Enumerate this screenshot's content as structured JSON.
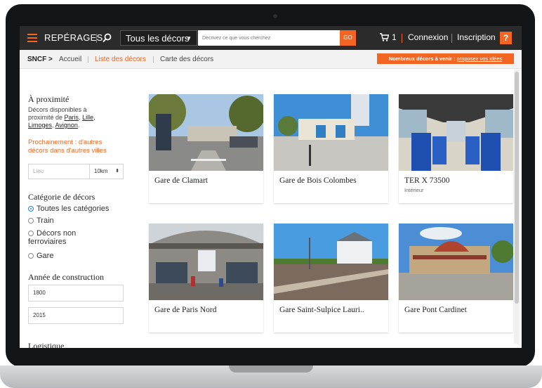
{
  "header": {
    "brand": "REPÉRAGES",
    "decor_dropdown": "Tous les décors",
    "search_placeholder": "Décrivez ce que vous cherchez",
    "go_label": "GO",
    "cart_count": "1",
    "connexion": "Connexion",
    "inscription": "Inscription",
    "help": "?"
  },
  "breadcrumb": {
    "sncf": "SNCF >",
    "home": "Accueil",
    "list": "Liste des décors",
    "map": "Carte des décors"
  },
  "promo": {
    "text": "Nombreux décors à venir : ",
    "link": "proposez vos idées"
  },
  "sidebar": {
    "nearby_title": "À proximité",
    "nearby_text": "Décors disponibles à proximité de ",
    "cities": [
      "Paris",
      "Lille",
      "Limoges",
      "Avignon"
    ],
    "soon_text": "Prochainement : d'autres décors dans d'autres villes",
    "location_placeholder": "Lieu",
    "radius": "10km",
    "category_title": "Catégorie de décors",
    "categories": [
      "Toutes les catégories",
      "Train",
      "Décors non ferroviaires",
      "Gare"
    ],
    "year_title": "Année de construction",
    "year_from": "1800",
    "year_to": "2015",
    "logistics_title": "Logistique"
  },
  "cards": [
    {
      "title": "Gare de Clamart",
      "sub": ""
    },
    {
      "title": "Gare de Bois Colombes",
      "sub": ""
    },
    {
      "title": "TER X 73500",
      "sub": "Intérieur"
    },
    {
      "title": "Gare de Paris Nord",
      "sub": ""
    },
    {
      "title": "Gare Saint-Sulpice Lauri..",
      "sub": ""
    },
    {
      "title": "Gare Pont Cardinet",
      "sub": ""
    }
  ],
  "colors": {
    "accent": "#f26522",
    "topbar": "#2b2b2b",
    "radio_selected": "#2d7fd8"
  }
}
